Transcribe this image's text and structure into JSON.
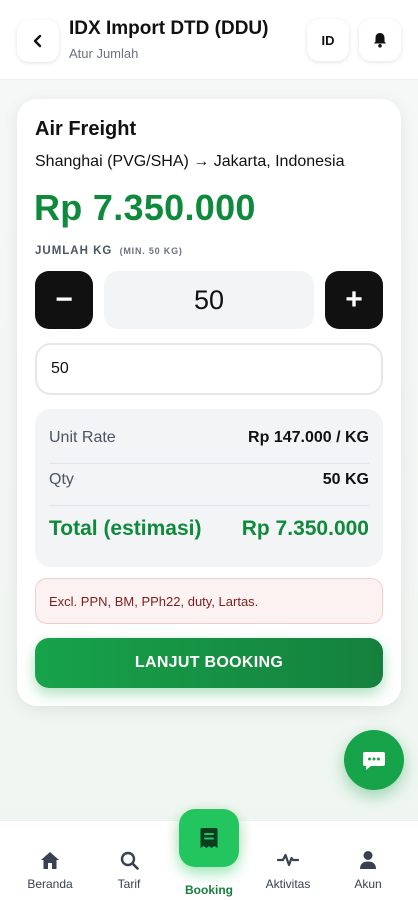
{
  "header": {
    "title": "IDX Import DTD (DDU)",
    "subtitle": "Atur Jumlah",
    "lang": "ID"
  },
  "card": {
    "mode": "Air Freight",
    "route": "Shanghai (PVG/SHA) → Jakarta, Indonesia",
    "price": "Rp 7.350.000",
    "qty_label": "JUMLAH KG",
    "qty_min": "(MIN. 50 KG)",
    "stepper_minus": "−",
    "stepper_plus": "+",
    "stepper_value": "50",
    "input_value": "50",
    "summary": {
      "unit_rate_label": "Unit Rate",
      "unit_rate_value": "Rp 147.000 / KG",
      "qty_label": "Qty",
      "qty_value": "50 KG",
      "total_label": "Total (estimasi)",
      "total_value": "Rp 7.350.000"
    },
    "notice": "Excl. PPN, BM, PPh22, duty, Lartas.",
    "cta": "LANJUT BOOKING"
  },
  "nav": {
    "items": [
      {
        "label": "Beranda",
        "icon": "home-icon"
      },
      {
        "label": "Tarif",
        "icon": "search-icon"
      },
      {
        "label": "Booking",
        "icon": "receipt-icon"
      },
      {
        "label": "Aktivitas",
        "icon": "activity-icon"
      },
      {
        "label": "Akun",
        "icon": "user-icon"
      }
    ]
  },
  "colors": {
    "brand_green": "#16a34a",
    "price_green": "#0f8a3c",
    "dark": "#111111"
  }
}
